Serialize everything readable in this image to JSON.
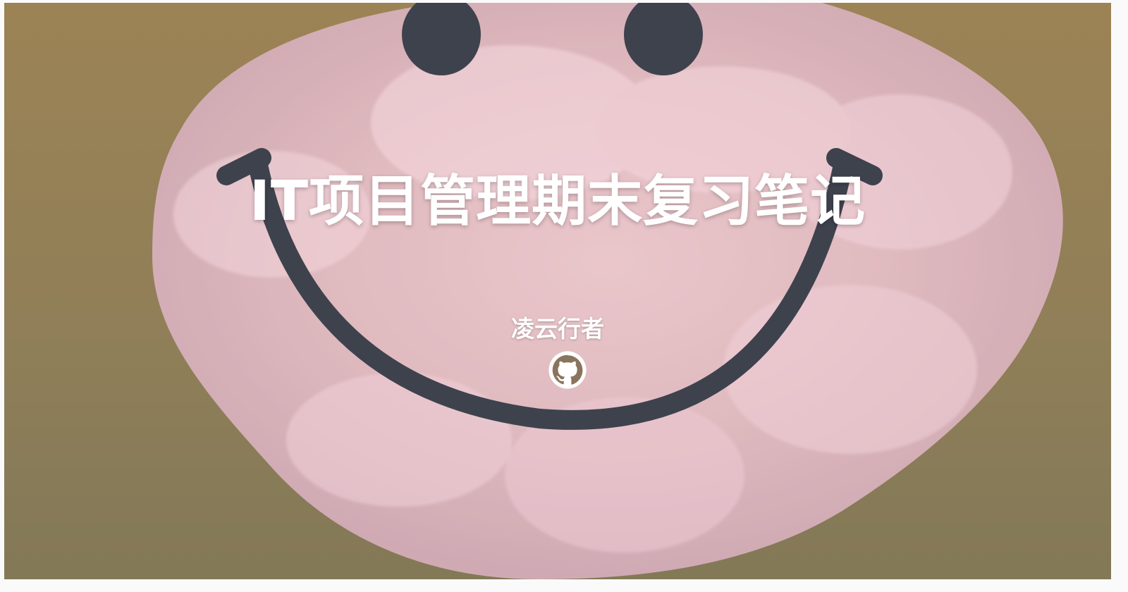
{
  "hero": {
    "title": "IT项目管理期末复习笔记",
    "author": "凌云行者",
    "social": {
      "icon": "github-icon"
    }
  },
  "colors": {
    "background": "#8c6f3a",
    "petal": "#e7b9c3",
    "smile": "#1f2430",
    "text": "#ffffff"
  }
}
